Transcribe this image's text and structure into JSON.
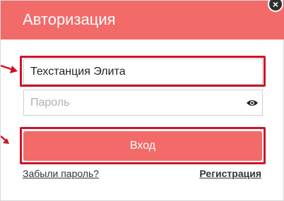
{
  "modal": {
    "title": "Авторизация",
    "close_symbol": "×"
  },
  "login_field": {
    "value": "Техстанция Элита"
  },
  "password_field": {
    "placeholder": "Пароль",
    "icon": "eye-icon"
  },
  "login_button": {
    "label": "Вход"
  },
  "links": {
    "forgot_password": "Забыли пароль?",
    "register": "Регистрация"
  },
  "colors": {
    "header": "#f26b68",
    "button": "#f26b68",
    "highlight": "#cc1428"
  }
}
